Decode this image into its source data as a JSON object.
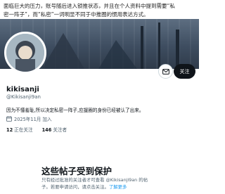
{
  "top_text": {
    "line1": "面临巨大的压力，账号随后进入锁推状态，并且在个人资料中提到需要“私",
    "line2": "密一阵子”，而“私密”一词明显不同于中推圈的惯用表达方式。"
  },
  "profile": {
    "name": "kikisanji",
    "handle": "@Kikisanji9an",
    "follow_label": "关注",
    "bio": "因为不懂羞耻,所以决定私密一阵子,应援圈的身份已经被认了出来。",
    "joined": "2025年11月 加入",
    "following_count": "12",
    "following_label": "正在关注",
    "followers_count": "146",
    "followers_label": "关注者"
  },
  "protected": {
    "title": "这些帖子受到保护",
    "line1": "只有经过批准的关注者才可查看 @Kikisanji9an 的帖",
    "line2_prefix": "子。若要申请访问，请点击关注。",
    "learn_more": "了解更多"
  },
  "colors": {
    "accent": "#1d9bf0",
    "text": "#0f1419",
    "muted": "#536471",
    "button_bg": "#0f1419"
  },
  "icons": [
    "mail-icon",
    "calendar-icon"
  ]
}
